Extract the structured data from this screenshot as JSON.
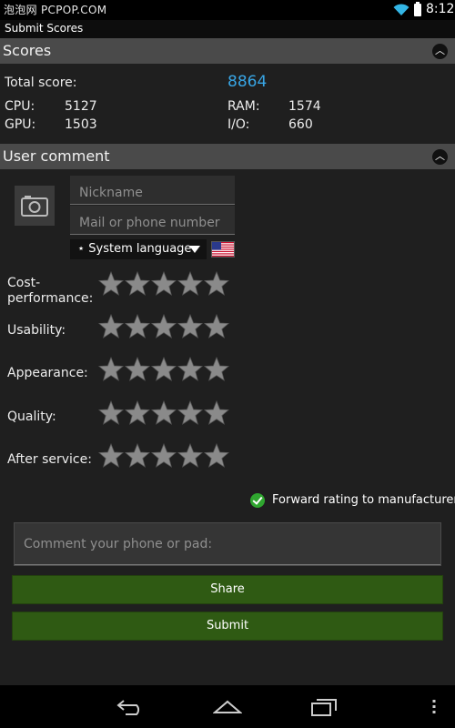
{
  "status_bar": {
    "watermark": "泡泡网 PCPOP.COM",
    "time": "8:12"
  },
  "title_bar": {
    "title": "Submit Scores"
  },
  "scores": {
    "header": "Scores",
    "total_label": "Total score:",
    "total_value": "8864",
    "cpu_label": "CPU:",
    "cpu_value": "5127",
    "gpu_label": "GPU:",
    "gpu_value": "1503",
    "ram_label": "RAM:",
    "ram_value": "1574",
    "io_label": "I/O:",
    "io_value": "660"
  },
  "user_comment": {
    "header": "User comment",
    "nickname_placeholder": "Nickname",
    "contact_placeholder": "Mail or phone number",
    "language": "⋆ System language"
  },
  "ratings": [
    {
      "label": "Cost-\nperformance:",
      "stars": 0
    },
    {
      "label": "Usability:",
      "stars": 0
    },
    {
      "label": "Appearance:",
      "stars": 0
    },
    {
      "label": "Quality:",
      "stars": 0
    },
    {
      "label": "After service:",
      "stars": 0
    }
  ],
  "forward_rating": {
    "label": "Forward rating to manufacturer",
    "checked": true
  },
  "comment_placeholder": "Comment your phone or pad:",
  "buttons": {
    "share": "Share",
    "submit": "Submit"
  },
  "colors": {
    "accent_blue": "#38a6e6",
    "button_green": "#2f5a13",
    "check_green": "#2fa62f"
  }
}
